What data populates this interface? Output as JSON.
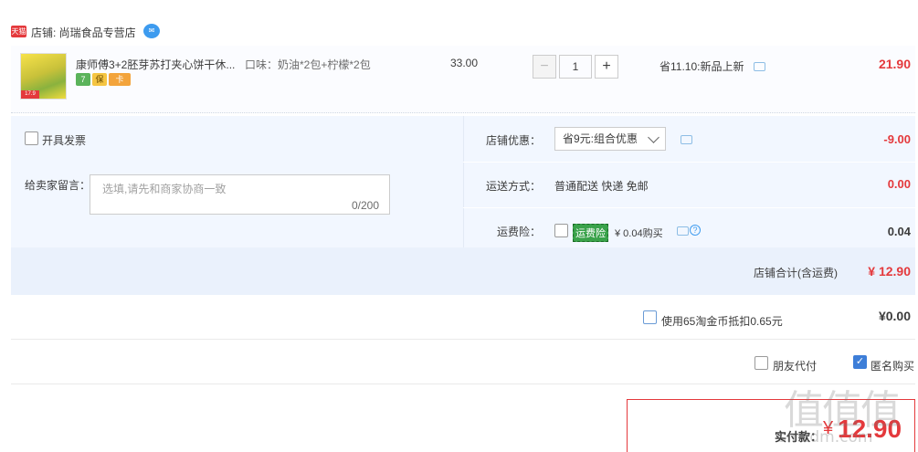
{
  "shop": {
    "platform_badge": "天猫",
    "label": "店铺: 尚瑞食品专营店"
  },
  "item": {
    "title": "康师傅3+2胚芽苏打夹心饼干休...",
    "attr": "口味：奶油*2包+柠檬*2包",
    "img_price_tag": "17.9",
    "unit_price": "33.00",
    "quantity": "1",
    "qty_minus": "−",
    "qty_plus": "+",
    "promo": "省11.10:新品上新",
    "total": "21.90",
    "service_icons": [
      "7",
      "保",
      "卡"
    ]
  },
  "invoice": {
    "label": "开具发票"
  },
  "memo": {
    "label": "给卖家留言：",
    "placeholder": "选填,请先和商家协商一致",
    "count": "0/200"
  },
  "shop_promo": {
    "label": "店铺优惠：",
    "selected": "省9元:组合优惠",
    "amount": "-9.00"
  },
  "shipping": {
    "label": "运送方式：",
    "value": "普通配送 快递 免邮",
    "fee": "0.00"
  },
  "insurance": {
    "label": "运费险：",
    "tag": "运费险",
    "price_text": "¥ 0.04购买",
    "help": "?",
    "fee": "0.04"
  },
  "shop_total": {
    "label": "店铺合计(含运费)",
    "amount": "¥ 12.90"
  },
  "coins": {
    "label": "使用65淘金币抵扣0.65元",
    "amount": "¥0.00"
  },
  "options": {
    "friend_pay": "朋友代付",
    "anonymous": "匿名购买",
    "anonymous_checked": true
  },
  "payment": {
    "label": "实付款：",
    "currency": "¥",
    "amount": "12.90"
  },
  "watermark": {
    "text": "值值值",
    "url": "smzdm.com"
  },
  "colors": {
    "accent_red": "#e4393c",
    "panel_blue": "#f2f7ff",
    "checkbox_blue": "#3d7ed8"
  }
}
